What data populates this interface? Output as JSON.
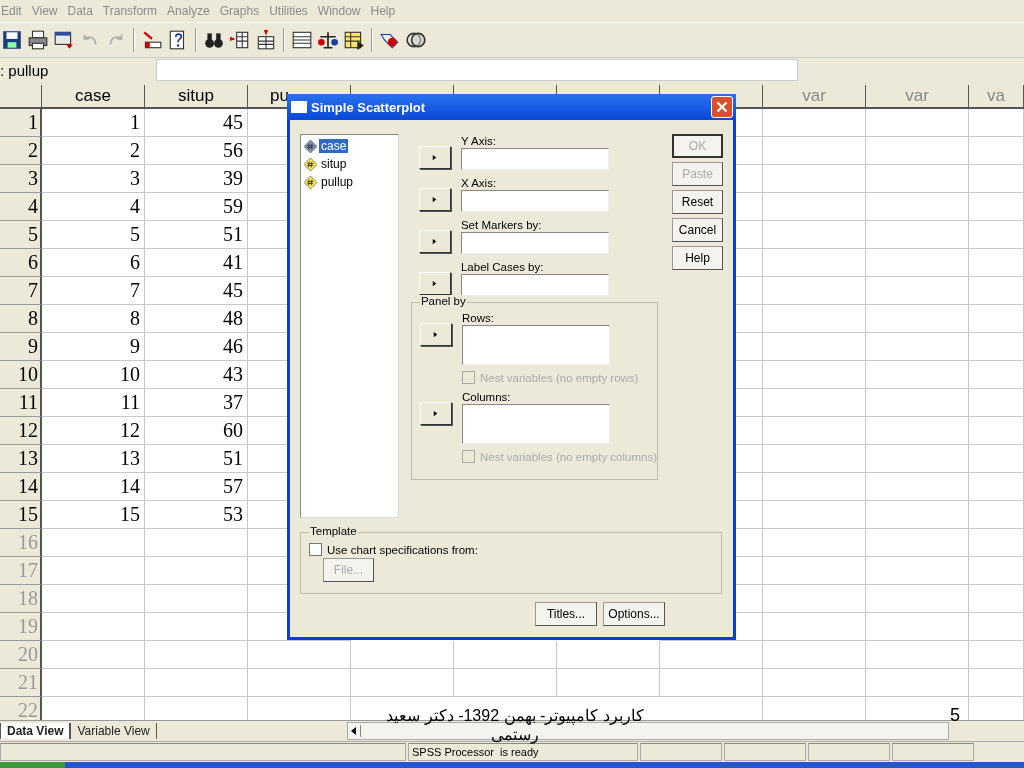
{
  "menu": [
    "Edit",
    "View",
    "Data",
    "Transform",
    "Analyze",
    "Graphs",
    "Utilities",
    "Window",
    "Help"
  ],
  "cell_editor": {
    "label": ": pullup"
  },
  "grid": {
    "columns_left": [
      "case",
      "situp",
      "pu"
    ],
    "columns_right": [
      "var",
      "var",
      "va"
    ],
    "rows": [
      {
        "number": "1",
        "cells": [
          "1",
          "45"
        ]
      },
      {
        "number": "2",
        "cells": [
          "2",
          "56"
        ]
      },
      {
        "number": "3",
        "cells": [
          "3",
          "39"
        ]
      },
      {
        "number": "4",
        "cells": [
          "4",
          "59"
        ]
      },
      {
        "number": "5",
        "cells": [
          "5",
          "51"
        ]
      },
      {
        "number": "6",
        "cells": [
          "6",
          "41"
        ]
      },
      {
        "number": "7",
        "cells": [
          "7",
          "45"
        ]
      },
      {
        "number": "8",
        "cells": [
          "8",
          "48"
        ]
      },
      {
        "number": "9",
        "cells": [
          "9",
          "46"
        ]
      },
      {
        "number": "10",
        "cells": [
          "10",
          "43"
        ]
      },
      {
        "number": "11",
        "cells": [
          "11",
          "37"
        ]
      },
      {
        "number": "12",
        "cells": [
          "12",
          "60"
        ]
      },
      {
        "number": "13",
        "cells": [
          "13",
          "51"
        ]
      },
      {
        "number": "14",
        "cells": [
          "14",
          "57"
        ]
      },
      {
        "number": "15",
        "cells": [
          "15",
          "53"
        ]
      }
    ],
    "empty_rows": [
      "16",
      "17",
      "18",
      "19",
      "20",
      "21",
      "22"
    ]
  },
  "dialog": {
    "title": "Simple Scatterplot",
    "variables": [
      {
        "name": "case",
        "selected": true
      },
      {
        "name": "situp",
        "selected": false
      },
      {
        "name": "pullup",
        "selected": false
      }
    ],
    "targets": [
      {
        "label": "Y Axis:"
      },
      {
        "label": "X Axis:"
      },
      {
        "label": "Set Markers by:"
      },
      {
        "label": "Label Cases by:"
      }
    ],
    "buttons": [
      {
        "label": "OK",
        "disabled": true
      },
      {
        "label": "Paste",
        "disabled": true
      },
      {
        "label": "Reset",
        "disabled": false
      },
      {
        "label": "Cancel",
        "disabled": false
      },
      {
        "label": "Help",
        "disabled": false
      }
    ],
    "panel_by": {
      "title": "Panel by",
      "rows_label": "Rows:",
      "rows_nest": {
        "label": "Nest variables (no empty rows)",
        "checked": false,
        "disabled": true
      },
      "columns_label": "Columns:",
      "columns_nest": {
        "label": "Nest variables (no empty columns)",
        "checked": false,
        "disabled": true
      }
    },
    "template": {
      "title": "Template",
      "use_specs": {
        "label": "Use chart specifications from:",
        "checked": false
      },
      "file_button": {
        "label": "File...",
        "disabled": true
      }
    },
    "bottom_buttons": [
      "Titles...",
      "Options..."
    ]
  },
  "sheet_tabs": [
    {
      "label": "Data View",
      "selected": true
    },
    {
      "label": "Variable View",
      "selected": false
    }
  ],
  "status": "SPSS Processor  is ready",
  "slide_footer": {
    "text": "کاربرد کامپیوتر- بهمن 1392- دکتر سعید رستمی",
    "page": "5"
  }
}
